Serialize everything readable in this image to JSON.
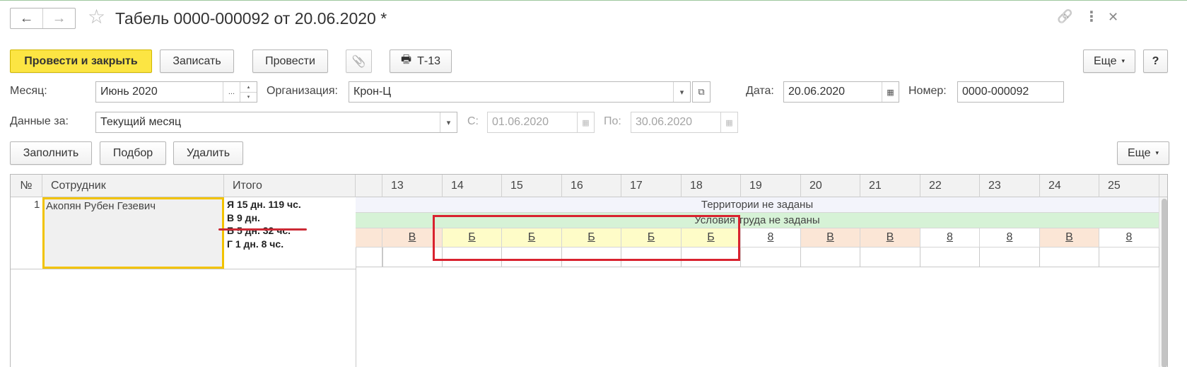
{
  "window": {
    "title": "Табель 0000-000092 от 20.06.2020 *"
  },
  "icons": {
    "back": "←",
    "forward": "→",
    "favorite": "☆",
    "link": "🔗",
    "more": "⋮",
    "close": "✕",
    "clip": "📎",
    "printer": "🖶",
    "dropdown": "▾",
    "calendar": "▦",
    "open": "⧉",
    "spin_up": "▴",
    "spin_down": "▾",
    "ellipsis": "..."
  },
  "toolbar": {
    "post_close": "Провести и закрыть",
    "save": "Записать",
    "post": "Провести",
    "print_t13": "Т-13",
    "more": "Еще",
    "help": "?"
  },
  "form": {
    "month_label": "Месяц:",
    "month_value": "Июнь 2020",
    "org_label": "Организация:",
    "org_value": "Крон-Ц",
    "date_label": "Дата:",
    "date_value": "20.06.2020",
    "number_label": "Номер:",
    "number_value": "0000-000092",
    "data_for_label": "Данные за:",
    "data_for_value": "Текущий месяц",
    "from_label": "С:",
    "from_value": "01.06.2020",
    "to_label": "По:",
    "to_value": "30.06.2020"
  },
  "table_toolbar": {
    "fill": "Заполнить",
    "pick": "Подбор",
    "delete": "Удалить",
    "more": "Еще"
  },
  "table": {
    "headers": {
      "num": "№",
      "employee": "Сотрудник",
      "total": "Итого"
    },
    "days": [
      "13",
      "14",
      "15",
      "16",
      "17",
      "18",
      "19",
      "20",
      "21",
      "22",
      "23",
      "24",
      "25"
    ],
    "row": {
      "num": "1",
      "employee": "Акопян Рубен Гезевич",
      "totals": [
        "Я 15 дн. 119 чс.",
        "В 9 дн.",
        "Б 5 дн. 32 чс.",
        "Г 1 дн. 8 чс."
      ],
      "territory": "Территории не заданы",
      "conditions": "Условия труда не заданы",
      "codes": [
        "В",
        "Б",
        "Б",
        "Б",
        "Б",
        "Б",
        "8",
        "В",
        "В",
        "8",
        "8",
        "В",
        "8"
      ]
    }
  },
  "colors": {
    "primary": "#fce543",
    "weekend": "#fbe6d6",
    "sick": "#fefcc8",
    "conditions_band": "#d6f2d6",
    "territory_band": "#f3f4fb",
    "annotation_red": "#d9222f",
    "selected_cell_border": "#f2c300"
  }
}
